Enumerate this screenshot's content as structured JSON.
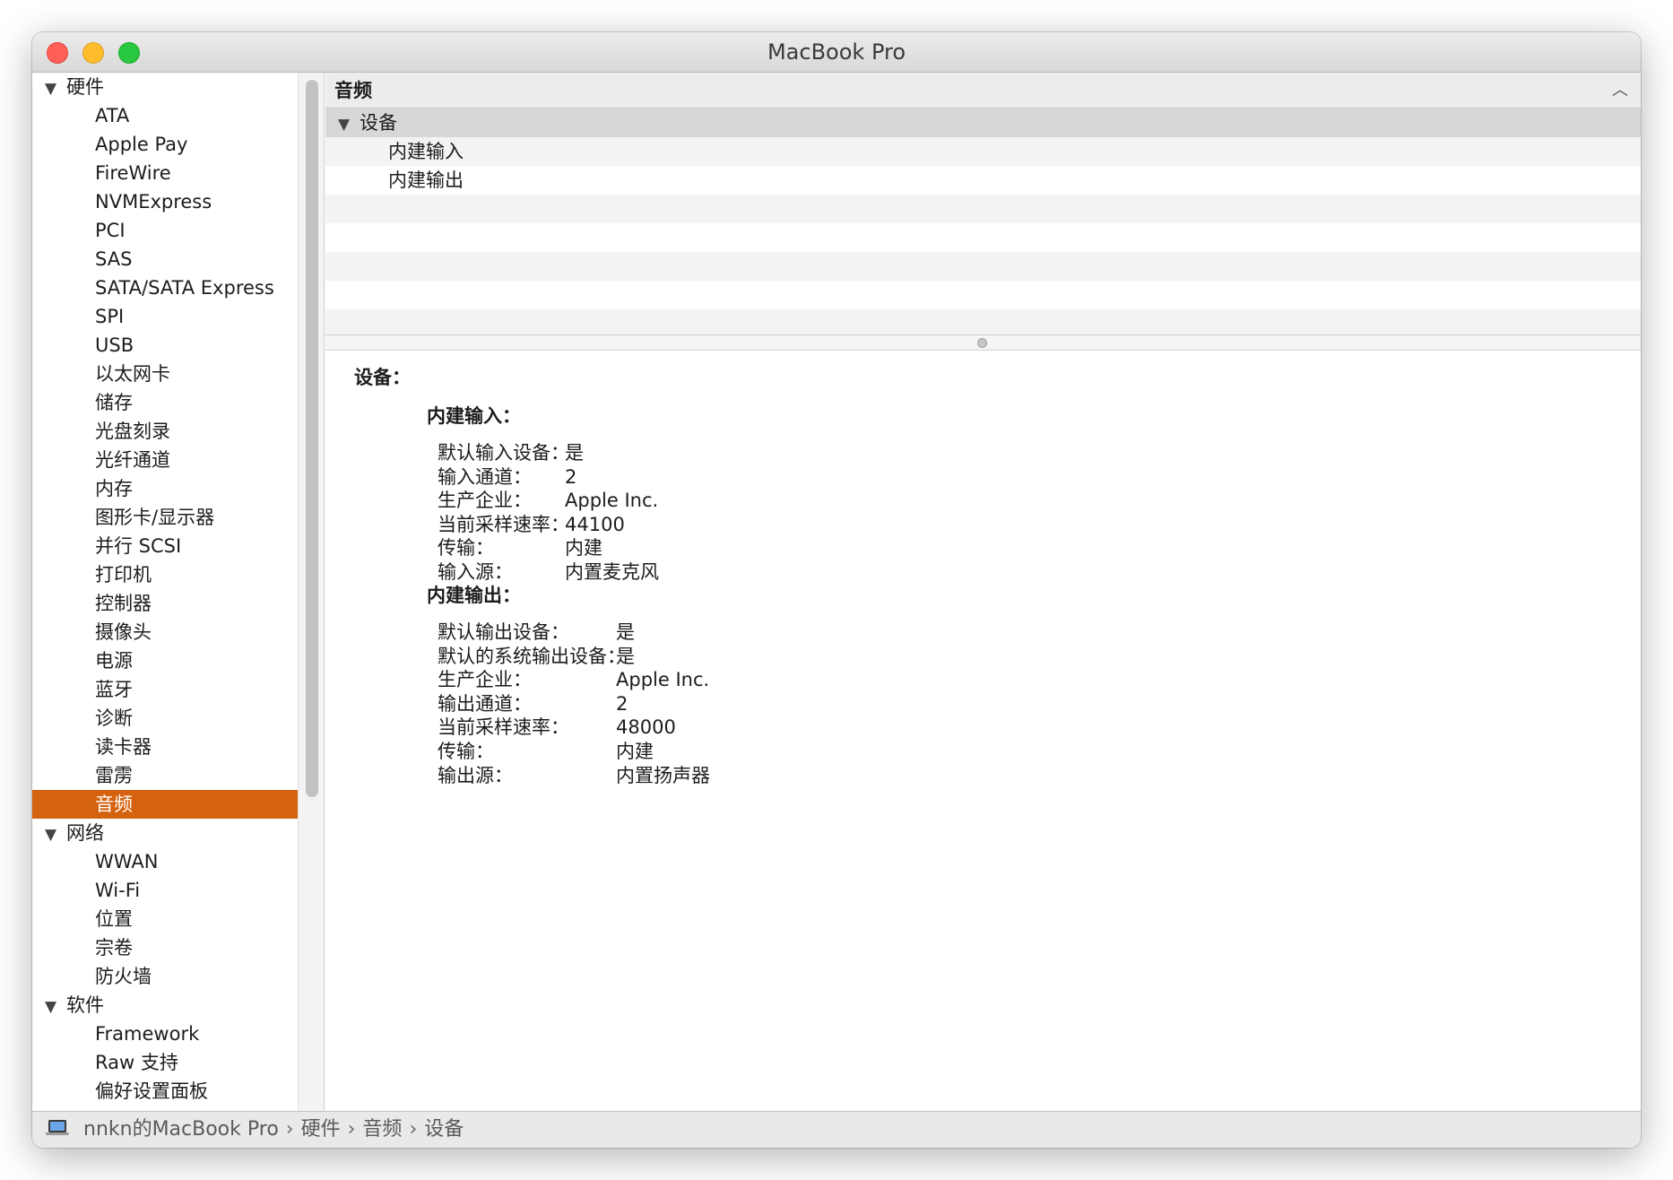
{
  "window": {
    "title": "MacBook Pro"
  },
  "sidebar": {
    "sections": [
      {
        "label": "硬件",
        "items": [
          "ATA",
          "Apple Pay",
          "FireWire",
          "NVMExpress",
          "PCI",
          "SAS",
          "SATA/SATA Express",
          "SPI",
          "USB",
          "以太网卡",
          "储存",
          "光盘刻录",
          "光纤通道",
          "内存",
          "图形卡/显示器",
          "并行 SCSI",
          "打印机",
          "控制器",
          "摄像头",
          "电源",
          "蓝牙",
          "诊断",
          "读卡器",
          "雷雳",
          "音频"
        ]
      },
      {
        "label": "网络",
        "items": [
          "WWAN",
          "Wi-Fi",
          "位置",
          "宗卷",
          "防火墙"
        ]
      },
      {
        "label": "软件",
        "items": [
          "Framework",
          "Raw 支持",
          "偏好设置面板"
        ]
      }
    ],
    "selected": "音频"
  },
  "table": {
    "header": "音频",
    "group": "设备",
    "children": [
      "内建输入",
      "内建输出"
    ]
  },
  "detail": {
    "title": "设备：",
    "devices": [
      {
        "name": "内建输入：",
        "props": [
          {
            "label": "默认输入设备：",
            "value": "是"
          },
          {
            "label": "输入通道：",
            "value": "2"
          },
          {
            "label": "生产企业：",
            "value": "Apple Inc."
          },
          {
            "label": "当前采样速率：",
            "value": "44100"
          },
          {
            "label": "传输：",
            "value": "内建"
          },
          {
            "label": "输入源：",
            "value": "内置麦克风"
          }
        ]
      },
      {
        "name": "内建输出：",
        "props": [
          {
            "label": "默认输出设备：",
            "value": "是"
          },
          {
            "label": "默认的系统输出设备：",
            "value": "是"
          },
          {
            "label": "生产企业：",
            "value": "Apple Inc."
          },
          {
            "label": "输出通道：",
            "value": "2"
          },
          {
            "label": "当前采样速率：",
            "value": "48000"
          },
          {
            "label": "传输：",
            "value": "内建"
          },
          {
            "label": "输出源：",
            "value": "内置扬声器"
          }
        ]
      }
    ]
  },
  "statusbar": {
    "icon": "laptop-icon",
    "breadcrumb": [
      "nnkn的MacBook Pro",
      "硬件",
      "音频",
      "设备"
    ],
    "separator": "›"
  },
  "colors": {
    "selection": "#d5620f",
    "group_row": "#d7d7d7",
    "alt_row": "#f3f3f3"
  }
}
